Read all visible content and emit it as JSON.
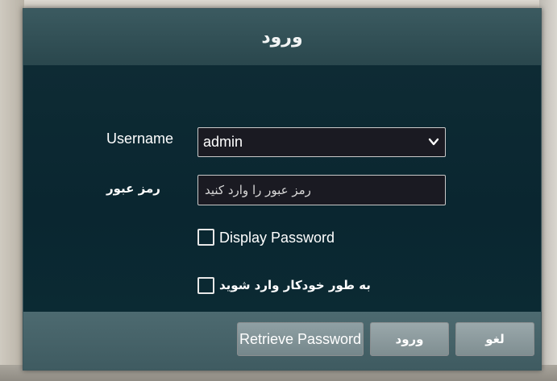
{
  "dialog": {
    "title": "ورود"
  },
  "form": {
    "username_label": "Username",
    "username_value": "admin",
    "password_label": "رمز عبور",
    "password_placeholder": "رمز عبور را وارد کنید",
    "display_password_label": "Display Password",
    "display_password_checked": false,
    "auto_login_label": "به طور خودکار وارد شوید",
    "auto_login_checked": false
  },
  "buttons": {
    "retrieve_password": "Retrieve Password",
    "login": "ورود",
    "cancel": "لغو"
  },
  "icons": {
    "dropdown": "chevron-down-icon"
  }
}
